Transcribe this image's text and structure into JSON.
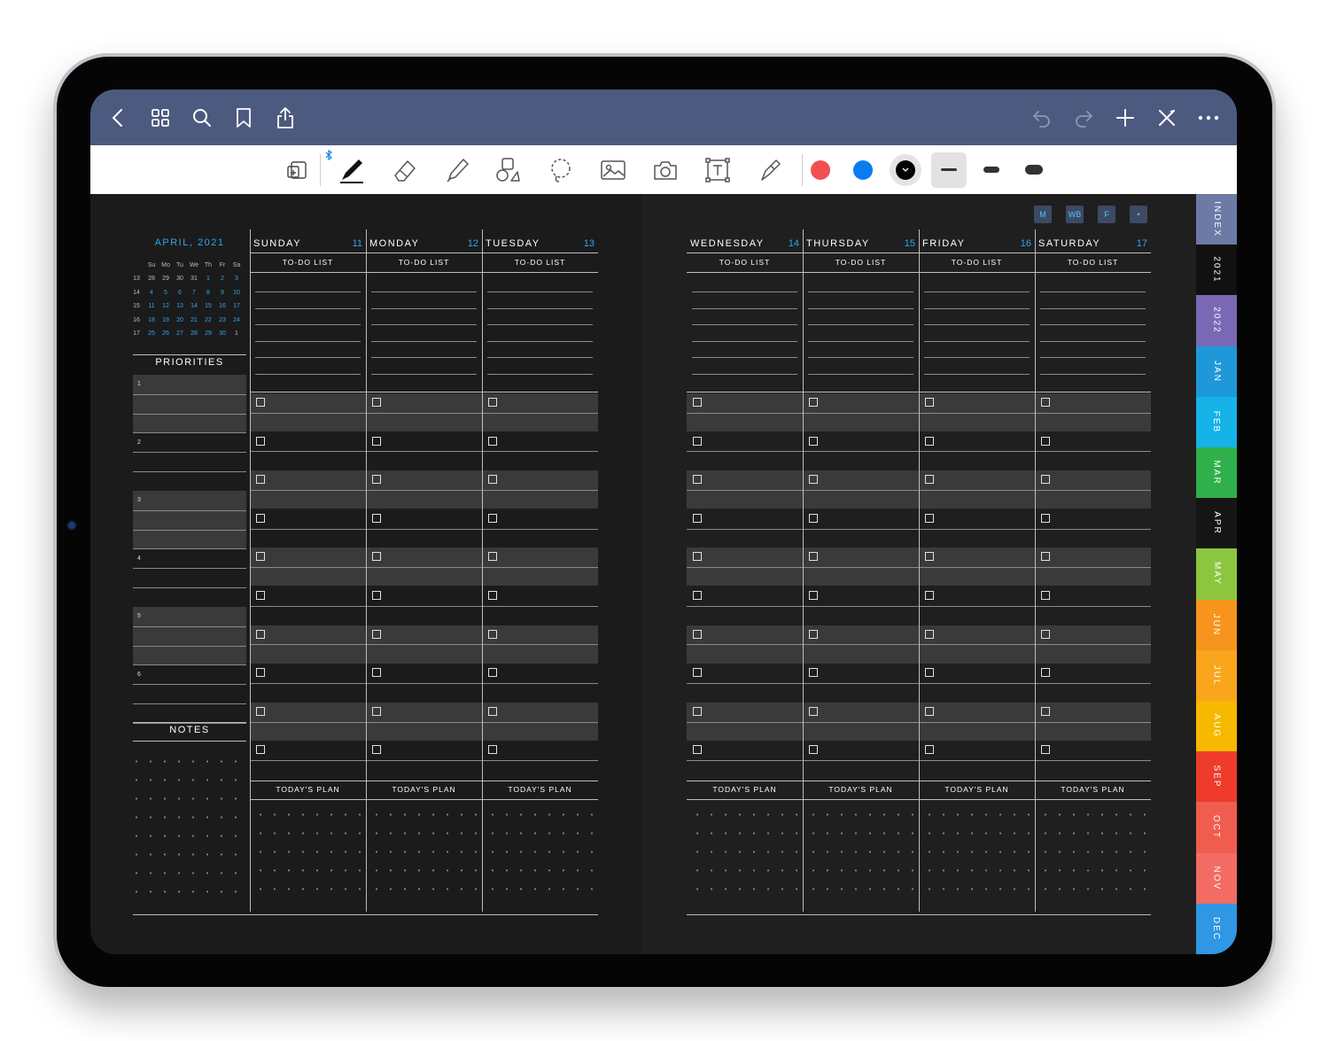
{
  "left_sidebar": {
    "month_title": "APRIL, 2021",
    "mini_calendar": {
      "weekday_headers": [
        "Su",
        "Mo",
        "Tu",
        "We",
        "Th",
        "Fr",
        "Sa"
      ],
      "rows": [
        {
          "week": "13",
          "days": [
            "28",
            "29",
            "30",
            "31",
            "1",
            "2",
            "3"
          ]
        },
        {
          "week": "14",
          "days": [
            "4",
            "5",
            "6",
            "7",
            "8",
            "9",
            "10"
          ]
        },
        {
          "week": "15",
          "days": [
            "11",
            "12",
            "13",
            "14",
            "15",
            "16",
            "17"
          ]
        },
        {
          "week": "16",
          "days": [
            "18",
            "19",
            "20",
            "21",
            "22",
            "23",
            "24"
          ]
        },
        {
          "week": "17",
          "days": [
            "25",
            "26",
            "27",
            "28",
            "29",
            "30",
            "1"
          ]
        }
      ]
    },
    "priorities_title": "PRIORITIES",
    "priority_numbers": [
      "1",
      "2",
      "3",
      "4",
      "5",
      "6"
    ],
    "notes_title": "NOTES"
  },
  "days": [
    {
      "name": "SUNDAY",
      "num": "11"
    },
    {
      "name": "MONDAY",
      "num": "12"
    },
    {
      "name": "TUESDAY",
      "num": "13"
    },
    {
      "name": "WEDNESDAY",
      "num": "14"
    },
    {
      "name": "THURSDAY",
      "num": "15"
    },
    {
      "name": "FRIDAY",
      "num": "16"
    },
    {
      "name": "SATURDAY",
      "num": "17"
    }
  ],
  "todo_label": "TO-DO LIST",
  "plan_label": "TODAY'S PLAN",
  "quick_links": [
    "M",
    "WB",
    "F",
    "•"
  ],
  "side_tabs": [
    {
      "label": "INDEX",
      "color": "#6d7aa5"
    },
    {
      "label": "2021",
      "color": "#111111"
    },
    {
      "label": "2022",
      "color": "#7b68b5"
    },
    {
      "label": "JAN",
      "color": "#1e98d8"
    },
    {
      "label": "FEB",
      "color": "#15b3e8"
    },
    {
      "label": "MAR",
      "color": "#2fb04a"
    },
    {
      "label": "APR",
      "color": "#151515"
    },
    {
      "label": "MAY",
      "color": "#8cc63f"
    },
    {
      "label": "JUN",
      "color": "#f7941d"
    },
    {
      "label": "JUL",
      "color": "#f9a61c"
    },
    {
      "label": "AUG",
      "color": "#f7b800"
    },
    {
      "label": "SEP",
      "color": "#ee3b2c"
    },
    {
      "label": "OCT",
      "color": "#f05d4e"
    },
    {
      "label": "NOV",
      "color": "#f26c63"
    },
    {
      "label": "DEC",
      "color": "#2f97e3"
    }
  ],
  "colors": {
    "nav_bg": "#4d5a7f",
    "accent_blue": "#2fa6f0",
    "pen_red": "#f0504f",
    "pen_blue": "#0a7cf2",
    "pen_black": "#000000"
  },
  "icons": {
    "nav_left": [
      "back-chevron-icon",
      "grid-icon",
      "search-icon",
      "bookmark-icon",
      "share-icon"
    ],
    "nav_right": [
      "undo-icon",
      "redo-icon",
      "plus-icon",
      "close-pen-icon",
      "more-icon"
    ],
    "tools": [
      "page-tool-icon",
      "bluetooth-icon",
      "pen-icon",
      "eraser-icon",
      "highlighter-icon",
      "shapes-icon",
      "lasso-icon",
      "image-icon",
      "camera-icon",
      "text-box-icon",
      "laser-icon"
    ]
  }
}
